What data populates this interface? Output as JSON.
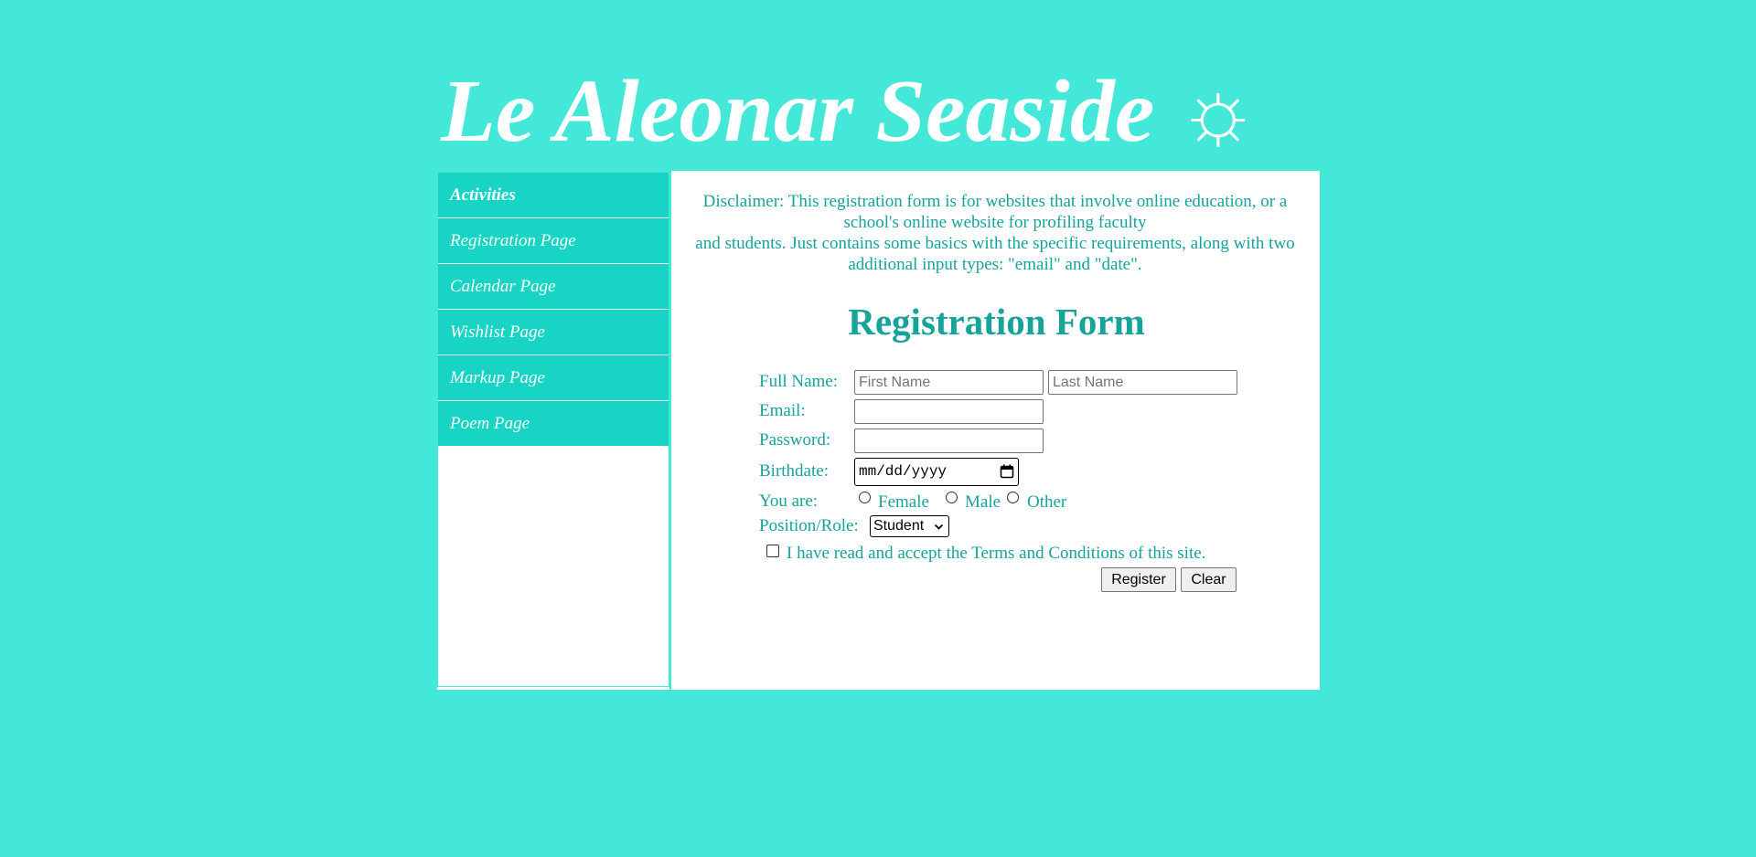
{
  "header": {
    "title": "Le Aleonar Seaside",
    "sun_glyph": "☼",
    "sun_icon": "sun-icon"
  },
  "sidebar": {
    "items": [
      {
        "label": "Activities",
        "active": true
      },
      {
        "label": "Registration Page",
        "active": false
      },
      {
        "label": "Calendar Page",
        "active": false
      },
      {
        "label": "Wishlist Page",
        "active": false
      },
      {
        "label": "Markup Page",
        "active": false
      },
      {
        "label": "Poem Page",
        "active": false
      }
    ]
  },
  "main": {
    "disclaimer_line1": "Disclaimer: This registration form is for websites that involve online education, or a school's online website for profiling faculty",
    "disclaimer_line2": "and students. Just contains some basics with the specific requirements, along with two additional input types: \"email\" and \"date\".",
    "form": {
      "title": "Registration Form",
      "full_name_label": "Full Name:",
      "first_name_placeholder": "First Name",
      "last_name_placeholder": "Last Name",
      "email_label": "Email:",
      "email_value": "",
      "password_label": "Password:",
      "password_value": "",
      "birthdate_label": "Birthdate:",
      "birthdate_placeholder": "mm/dd/yyyy",
      "you_are_label": "You are:",
      "gender_options": [
        "Female",
        "Male",
        "Other"
      ],
      "role_label": "Position/Role:",
      "role_selected": "Student",
      "terms_label": "I have read and accept the Terms and Conditions of this site.",
      "register_label": "Register",
      "clear_label": "Clear"
    }
  },
  "colors": {
    "page_background": "#43e8d8",
    "nav_background": "#17d4c4",
    "text_teal": "#16a39a",
    "white": "#ffffff"
  }
}
